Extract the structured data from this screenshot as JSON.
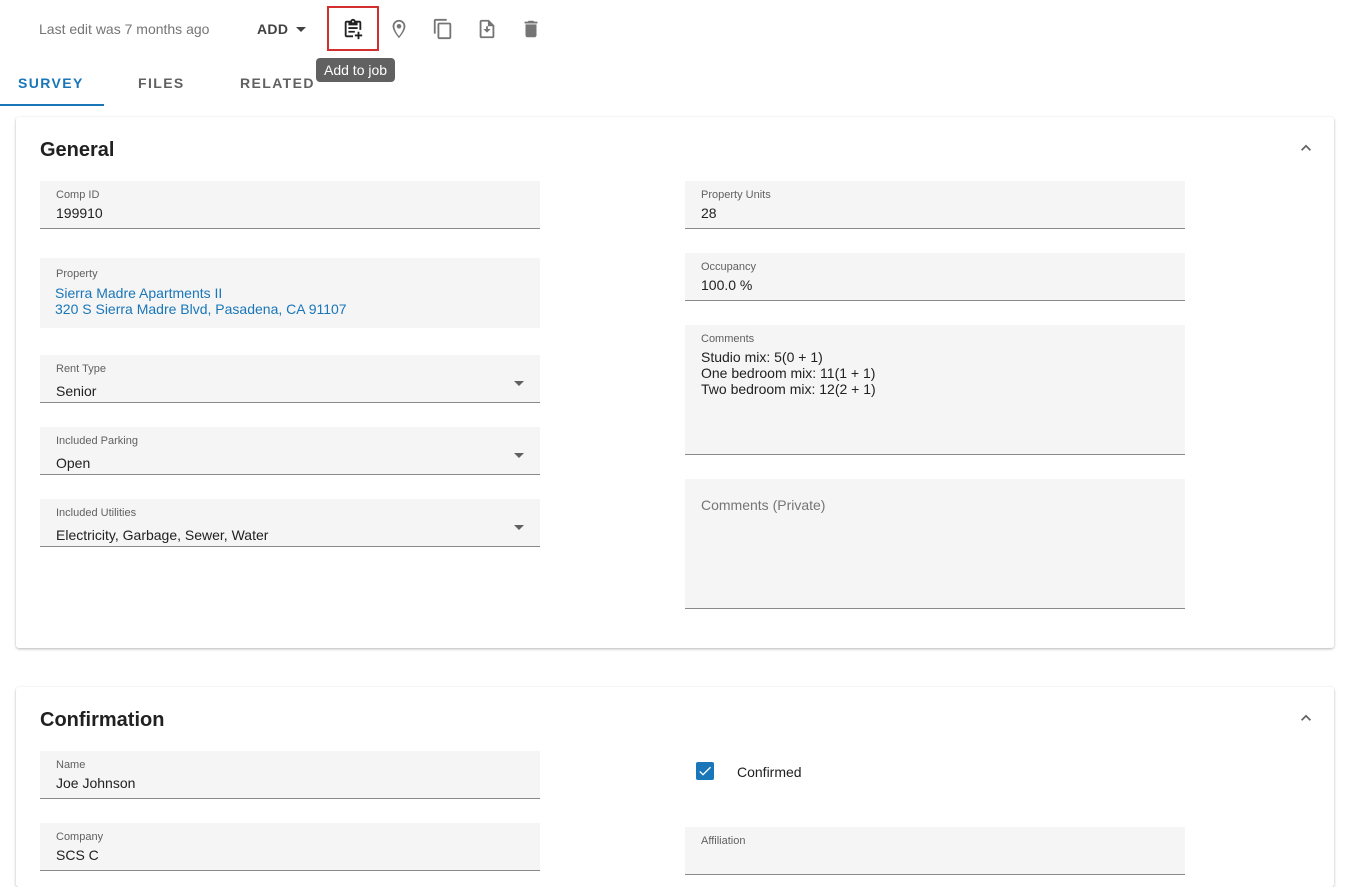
{
  "toolbar": {
    "last_edit": "Last edit was 7 months ago",
    "add_label": "ADD",
    "tooltip": "Add to job"
  },
  "tabs": [
    {
      "label": "SURVEY",
      "active": true
    },
    {
      "label": "FILES",
      "active": false
    },
    {
      "label": "RELATED",
      "active": false
    }
  ],
  "general": {
    "title": "General",
    "comp_id": {
      "label": "Comp ID",
      "value": "199910"
    },
    "property": {
      "label": "Property",
      "name": "Sierra Madre Apartments II",
      "address": "320 S Sierra Madre Blvd, Pasadena, CA 91107"
    },
    "rent_type": {
      "label": "Rent Type",
      "value": "Senior"
    },
    "included_parking": {
      "label": "Included Parking",
      "value": "Open"
    },
    "included_utilities": {
      "label": "Included Utilities",
      "value": "Electricity, Garbage, Sewer, Water"
    },
    "property_units": {
      "label": "Property Units",
      "value": "28"
    },
    "occupancy": {
      "label": "Occupancy",
      "value": "100.0 %"
    },
    "comments": {
      "label": "Comments",
      "value": "Studio mix: 5(0 + 1)\nOne bedroom mix: 11(1 + 1)\nTwo bedroom mix: 12(2 + 1)"
    },
    "comments_private": {
      "placeholder": "Comments (Private)"
    }
  },
  "confirmation": {
    "title": "Confirmation",
    "name": {
      "label": "Name",
      "value": "Joe Johnson"
    },
    "confirmed": {
      "label": "Confirmed",
      "checked": true
    },
    "company": {
      "label": "Company",
      "value": "SCS C"
    },
    "affiliation": {
      "label": "Affiliation"
    }
  },
  "colors": {
    "accent": "#1976b9",
    "highlight": "#d32f2f"
  }
}
